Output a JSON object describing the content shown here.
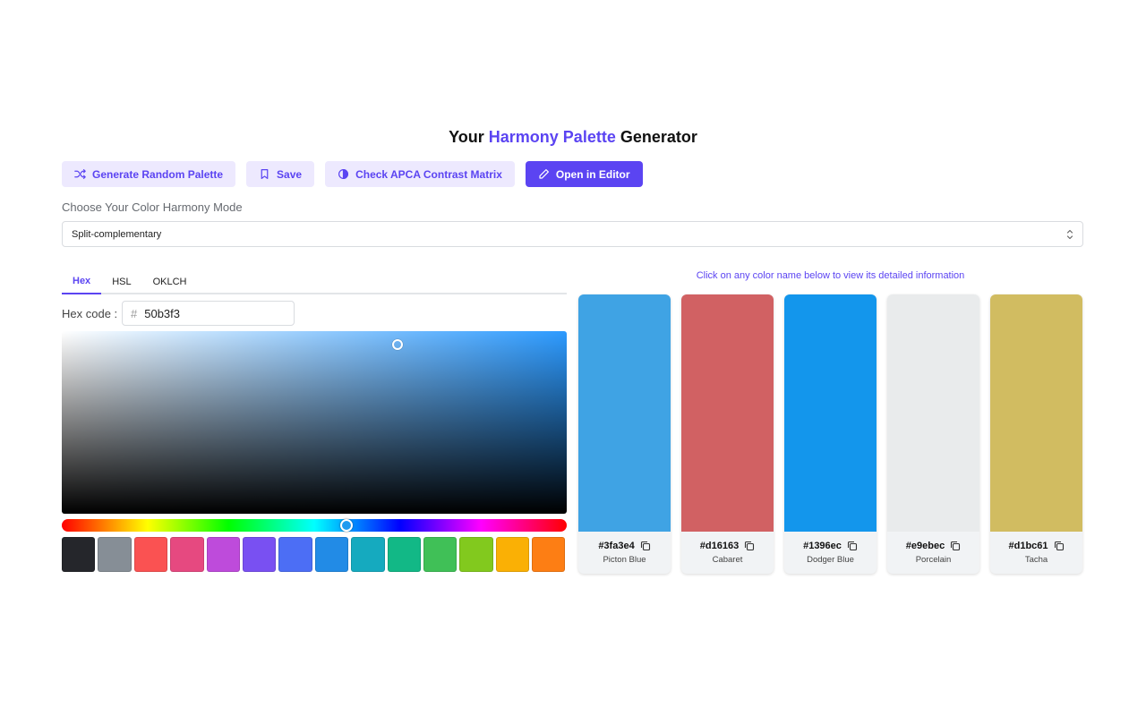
{
  "header": {
    "title_prefix": "Your",
    "title_accent": "Harmony Palette",
    "title_suffix": "Generator",
    "accent_color": "#5b44f2"
  },
  "toolbar": {
    "random_label": "Generate Random Palette",
    "save_label": "Save",
    "contrast_label": "Check APCA Contrast Matrix",
    "editor_label": "Open in Editor"
  },
  "mode": {
    "label": "Choose Your Color Harmony Mode",
    "selected": "Split-complementary"
  },
  "picker": {
    "tabs": [
      {
        "label": "Hex",
        "active": true
      },
      {
        "label": "HSL",
        "active": false
      },
      {
        "label": "OKLCH",
        "active": false
      }
    ],
    "hex_label": "Hex code :",
    "hex_prefix": "#",
    "hex_value": "50b3f3",
    "swatches": [
      "#25262b",
      "#868e96",
      "#fa5252",
      "#e64980",
      "#be4bdb",
      "#7950f2",
      "#4c6ef5",
      "#228be6",
      "#15aabf",
      "#12b886",
      "#40c057",
      "#82c91e",
      "#fab005",
      "#fd7e14"
    ]
  },
  "palette": {
    "hint": "Click on any color name below to view its detailed information",
    "colors": [
      {
        "hex": "#3fa3e4",
        "name": "Picton Blue"
      },
      {
        "hex": "#d16163",
        "name": "Cabaret"
      },
      {
        "hex": "#1396ec",
        "name": "Dodger Blue"
      },
      {
        "hex": "#e9ebec",
        "name": "Porcelain"
      },
      {
        "hex": "#d1bc61",
        "name": "Tacha"
      }
    ]
  }
}
